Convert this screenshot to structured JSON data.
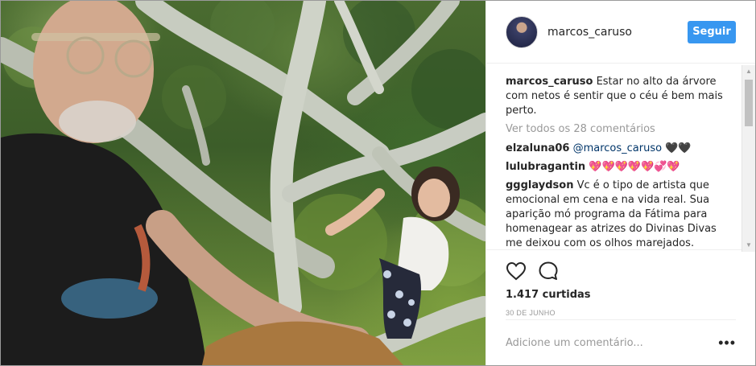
{
  "post": {
    "username": "marcos_caruso",
    "follow_label": "Seguir",
    "caption": {
      "user": "marcos_caruso",
      "text": "Estar no alto da árvore com netos é sentir que o céu é bem mais perto."
    },
    "view_all_comments": "Ver todos os 28 comentários",
    "comments": [
      {
        "user": "elzaluna06",
        "mention": "@marcos_caruso",
        "text": "🖤🖤"
      },
      {
        "user": "lulubragantin",
        "mention": "",
        "text": "💖💖💖💖💖💞💖"
      },
      {
        "user": "ggglaydson",
        "mention": "",
        "text": "Vc é o tipo de artista que emocional em cena e na vida real. Sua aparição mó programa da Fátima para homenagear as atrizes do Divinas Divas me deixou com os olhos marejados."
      }
    ],
    "likes": "1.417 curtidas",
    "date": "30 DE JUNHO",
    "add_comment_placeholder": "Adicione um comentário...",
    "more_options": "•••"
  },
  "icons": {
    "like": "heart-icon",
    "comment": "speech-bubble-icon",
    "more": "ellipsis-icon"
  },
  "colors": {
    "follow_button": "#3897f0",
    "text": "#262626",
    "muted": "#999999",
    "mention": "#003569"
  }
}
